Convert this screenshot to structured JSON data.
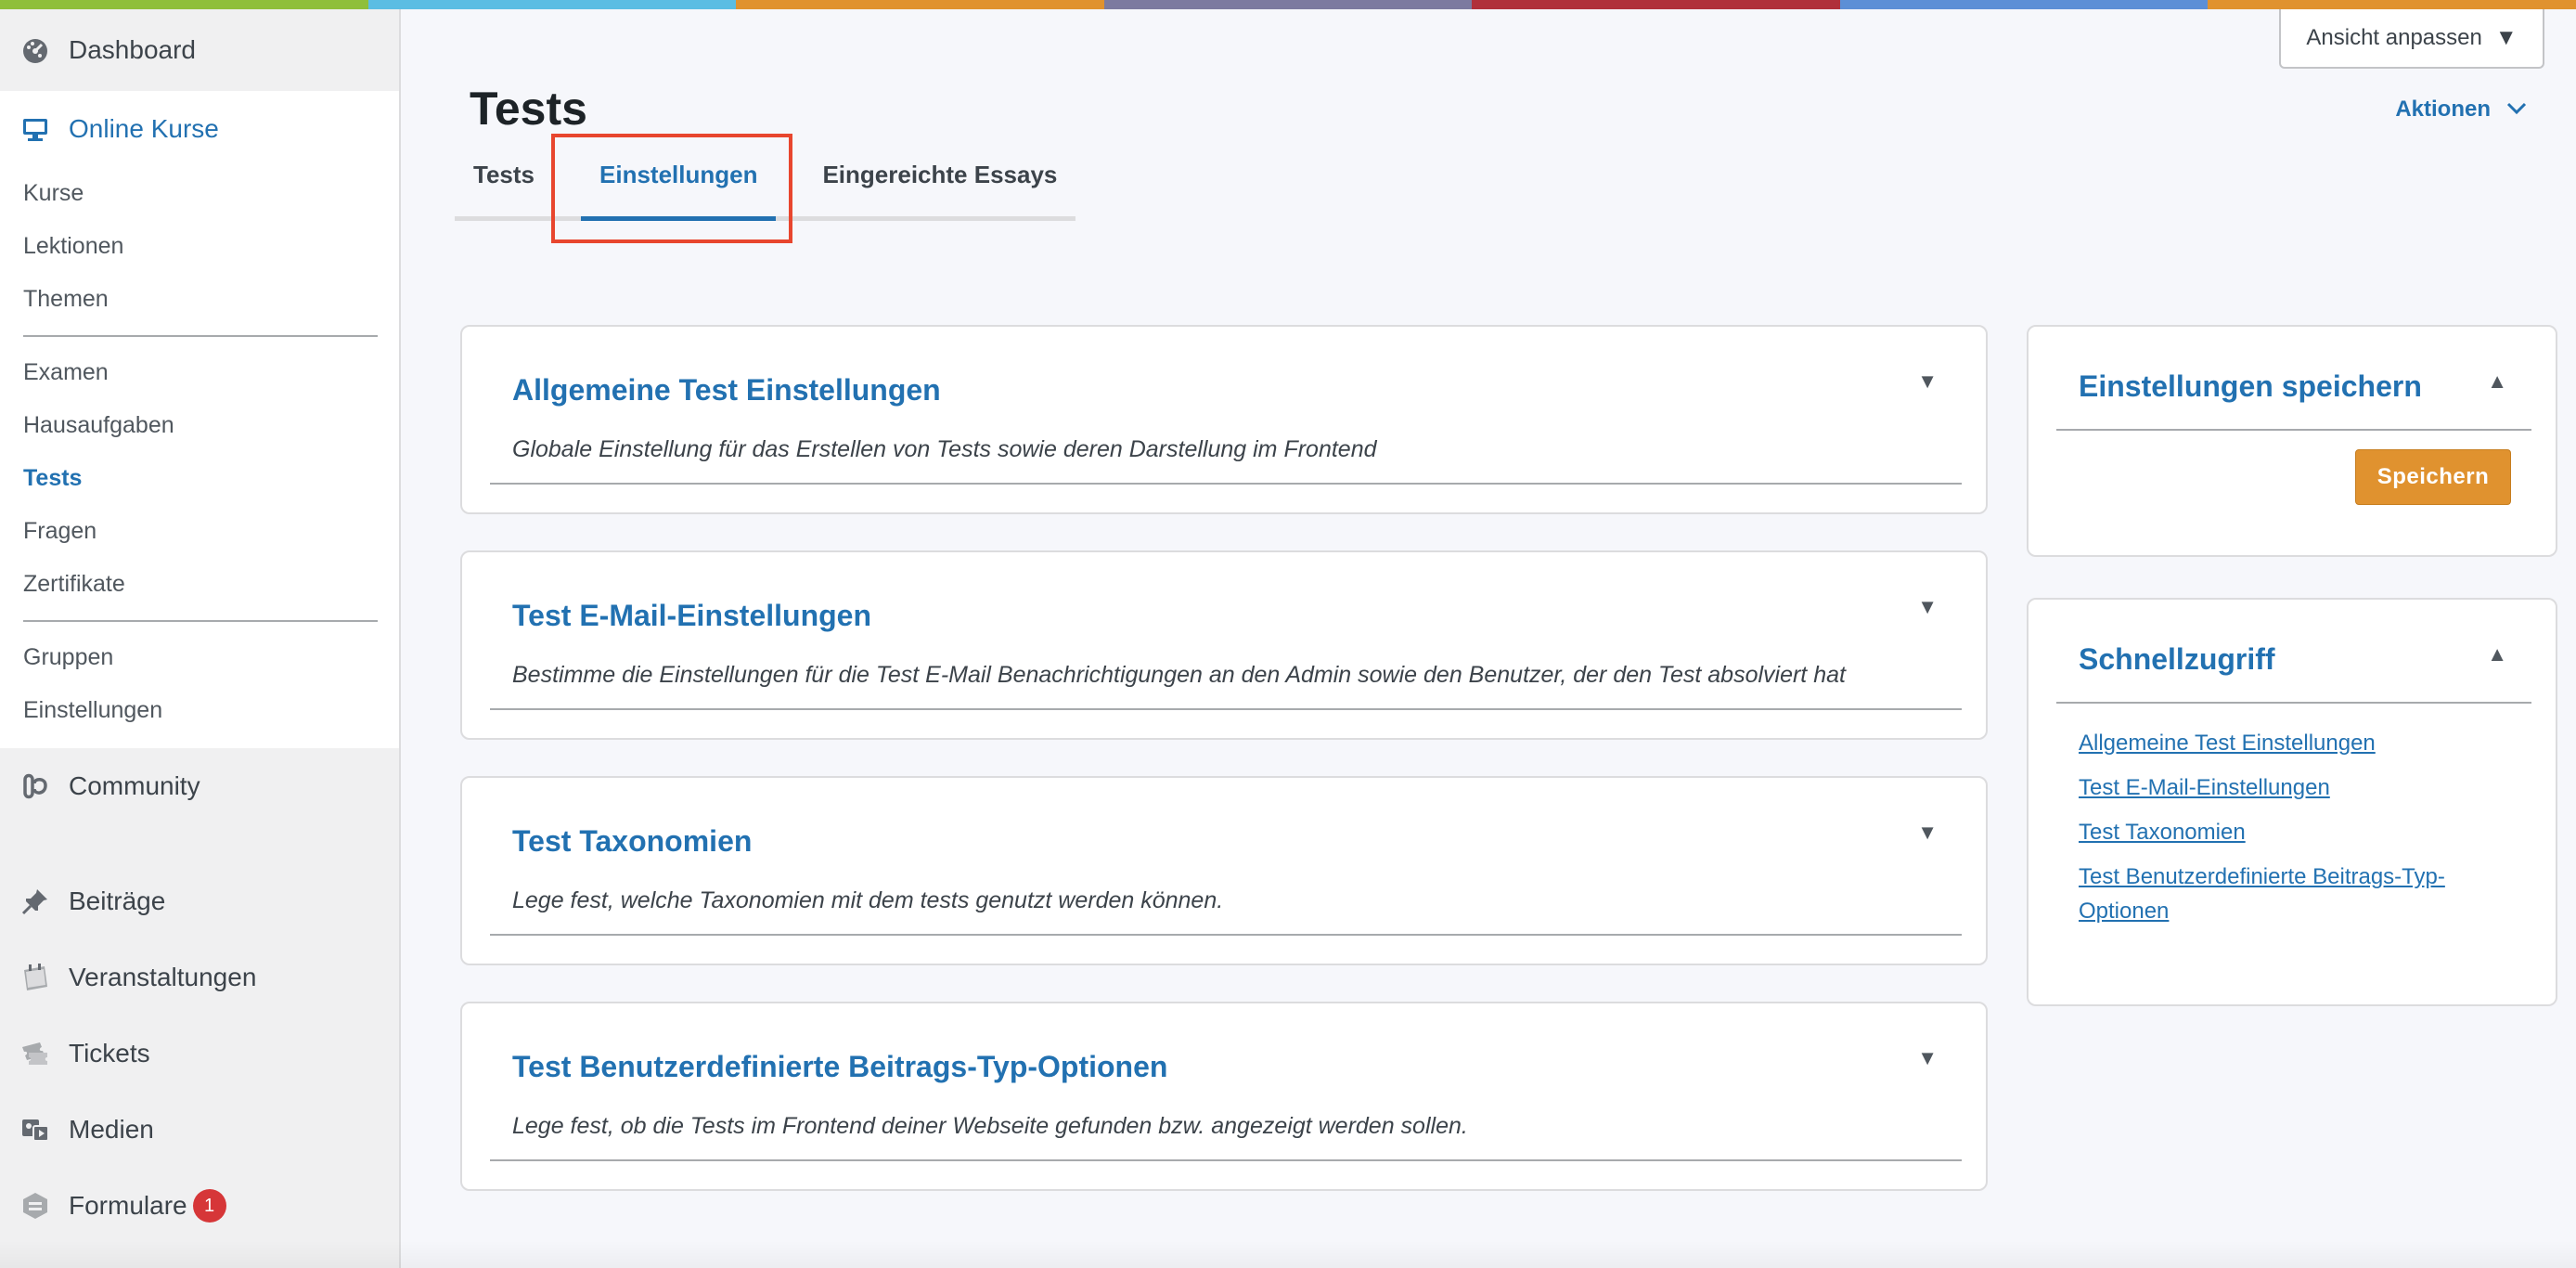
{
  "stripe_colors": [
    "#8fbf3b",
    "#5bbde3",
    "#e0922f",
    "#7c7aa0",
    "#b0303a",
    "#5c8fd6",
    "#e0922f"
  ],
  "sidebar": {
    "dashboard": "Dashboard",
    "current_section": "Online Kurse",
    "submenu": {
      "group1": [
        "Kurse",
        "Lektionen",
        "Themen"
      ],
      "group2": [
        "Examen",
        "Hausaufgaben",
        "Tests",
        "Fragen",
        "Zertifikate"
      ],
      "group3": [
        "Gruppen",
        "Einstellungen"
      ]
    },
    "active_sub": "Tests",
    "items": [
      {
        "label": "Community",
        "icon": "community-icon"
      },
      {
        "label": "Beiträge",
        "icon": "pin-icon"
      },
      {
        "label": "Veranstaltungen",
        "icon": "calendar-icon"
      },
      {
        "label": "Tickets",
        "icon": "ticket-icon"
      },
      {
        "label": "Medien",
        "icon": "media-icon"
      },
      {
        "label": "Formulare",
        "icon": "forms-icon",
        "badge": "1"
      }
    ]
  },
  "header": {
    "view_button": "Ansicht anpassen",
    "title": "Tests",
    "actions": "Aktionen"
  },
  "tabs": [
    {
      "label": "Tests",
      "active": false
    },
    {
      "label": "Einstellungen",
      "active": true
    },
    {
      "label": "Eingereichte Essays",
      "active": false
    }
  ],
  "sections": [
    {
      "title": "Allgemeine Test Einstellungen",
      "description": "Globale Einstellung für das Erstellen von Tests sowie deren Darstellung im Frontend"
    },
    {
      "title": "Test E-Mail-Einstellungen",
      "description": "Bestimme die Einstellungen für die Test E-Mail Benachrichtigungen an den Admin sowie den Benutzer, der den Test absolviert hat"
    },
    {
      "title": "Test Taxonomien",
      "description": "Lege fest, welche Taxonomien mit dem tests genutzt werden können."
    },
    {
      "title": "Test Benutzerdefinierte Beitrags-Typ-Optionen",
      "description": "Lege fest, ob die Tests im Frontend deiner Webseite gefunden bzw. angezeigt werden sollen."
    }
  ],
  "save_box": {
    "title": "Einstellungen speichern",
    "button": "Speichern"
  },
  "quick_access": {
    "title": "Schnellzugriff",
    "links": [
      "Allgemeine Test Einstellungen",
      "Test E-Mail-Einstellungen",
      "Test Taxonomien",
      "Test Benutzerdefinierte Beitrags-Typ-Optionen"
    ]
  },
  "colors": {
    "accent": "#2271b1",
    "button": "#e0922f",
    "highlight": "#e8462e",
    "badge": "#d63638"
  }
}
